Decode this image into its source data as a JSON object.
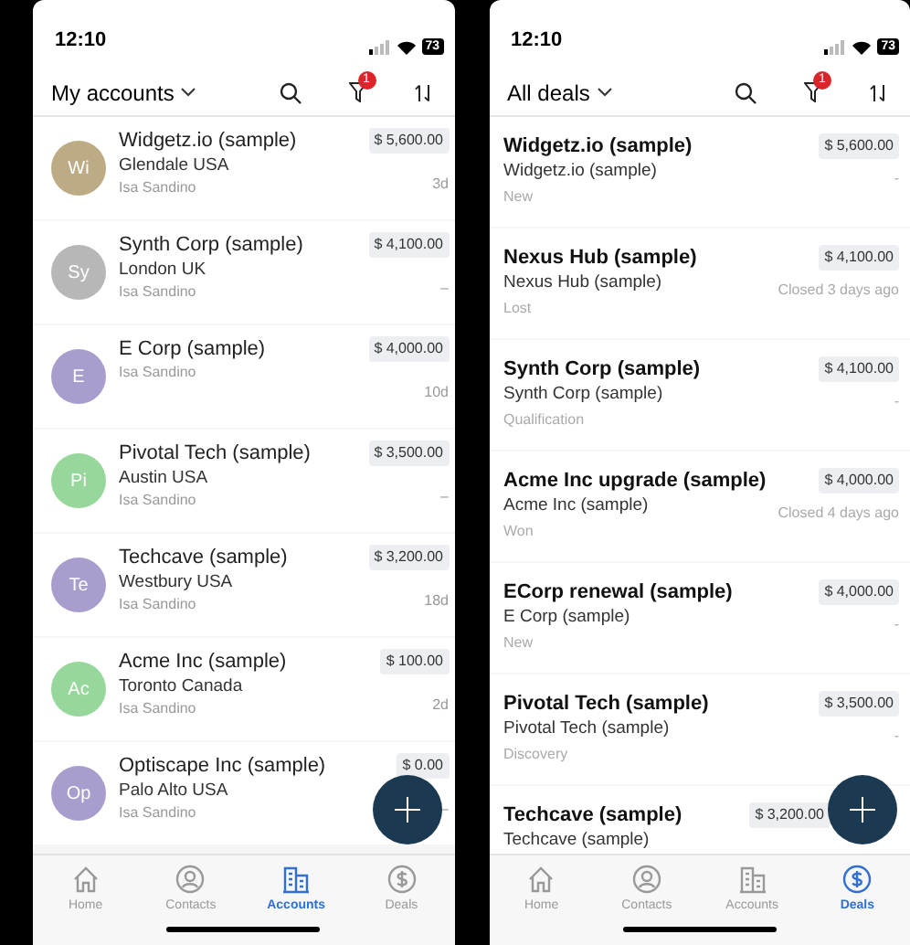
{
  "screens": [
    {
      "status_bar": {
        "time": "12:10",
        "battery": "73"
      },
      "header": {
        "title": "My accounts",
        "filter_badge": "1"
      },
      "rows": [
        {
          "kind": "account",
          "initials": "Wi",
          "color": "#bcab84",
          "name": "Widgetz.io (sample)",
          "location": "Glendale USA",
          "owner": "Isa Sandino",
          "amount": "$ 5,600.00",
          "age": "3d"
        },
        {
          "kind": "account",
          "initials": "Sy",
          "color": "#b7b7b7",
          "name": "Synth Corp (sample)",
          "location": "London UK",
          "owner": "Isa Sandino",
          "amount": "$ 4,100.00",
          "age": "–"
        },
        {
          "kind": "account",
          "initials": "E",
          "color": "#a99dcd",
          "name": "E Corp (sample)",
          "owner": "Isa Sandino",
          "amount": "$ 4,000.00",
          "age": "10d"
        },
        {
          "kind": "account",
          "initials": "Pi",
          "color": "#97d79b",
          "name": "Pivotal Tech (sample)",
          "location": "Austin USA",
          "owner": "Isa Sandino",
          "amount": "$ 3,500.00",
          "age": "–"
        },
        {
          "kind": "account",
          "initials": "Te",
          "color": "#a99dcd",
          "name": "Techcave (sample)",
          "location": "Westbury USA",
          "owner": "Isa Sandino",
          "amount": "$ 3,200.00",
          "age": "18d"
        },
        {
          "kind": "account",
          "initials": "Ac",
          "color": "#97d79b",
          "name": "Acme Inc (sample)",
          "location": "Toronto Canada",
          "owner": "Isa Sandino",
          "amount": "$ 100.00",
          "age": "2d"
        },
        {
          "kind": "account",
          "initials": "Op",
          "color": "#a99dcd",
          "name": "Optiscape Inc (sample)",
          "location": "Palo Alto USA",
          "owner": "Isa Sandino",
          "amount": "$ 0.00",
          "age": "–"
        }
      ],
      "tabs": [
        {
          "label": "Home",
          "selected": false
        },
        {
          "label": "Contacts",
          "selected": false
        },
        {
          "label": "Accounts",
          "selected": true
        },
        {
          "label": "Deals",
          "selected": false
        }
      ]
    },
    {
      "status_bar": {
        "time": "12:10",
        "battery": "73"
      },
      "header": {
        "title": "All deals",
        "filter_badge": "1"
      },
      "rows": [
        {
          "kind": "deal",
          "name": "Widgetz.io (sample)",
          "account": "Widgetz.io (sample)",
          "stage": "New",
          "amount": "$ 5,600.00",
          "closed": "-"
        },
        {
          "kind": "deal",
          "name": "Nexus Hub (sample)",
          "account": "Nexus Hub (sample)",
          "stage": "Lost",
          "amount": "$ 4,100.00",
          "closed": "Closed 3 days ago"
        },
        {
          "kind": "deal",
          "name": "Synth Corp (sample)",
          "account": "Synth Corp (sample)",
          "stage": "Qualification",
          "amount": "$ 4,100.00",
          "closed": "-"
        },
        {
          "kind": "deal",
          "name": "Acme Inc upgrade (sample)",
          "account": "Acme Inc (sample)",
          "stage": "Won",
          "amount": "$ 4,000.00",
          "closed": "Closed 4 days ago"
        },
        {
          "kind": "deal",
          "name": "ECorp renewal (sample)",
          "account": "E Corp (sample)",
          "stage": "New",
          "amount": "$ 4,000.00",
          "closed": "-"
        },
        {
          "kind": "deal",
          "name": "Pivotal Tech (sample)",
          "account": "Pivotal Tech (sample)",
          "stage": "Discovery",
          "amount": "$ 3,500.00",
          "closed": "-"
        },
        {
          "kind": "deal",
          "name": "Techcave (sample)",
          "account": "Techcave (sample)",
          "amount": "$ 3,200.00"
        }
      ],
      "tabs": [
        {
          "label": "Home",
          "selected": false
        },
        {
          "label": "Contacts",
          "selected": false
        },
        {
          "label": "Accounts",
          "selected": false
        },
        {
          "label": "Deals",
          "selected": true
        }
      ]
    }
  ]
}
